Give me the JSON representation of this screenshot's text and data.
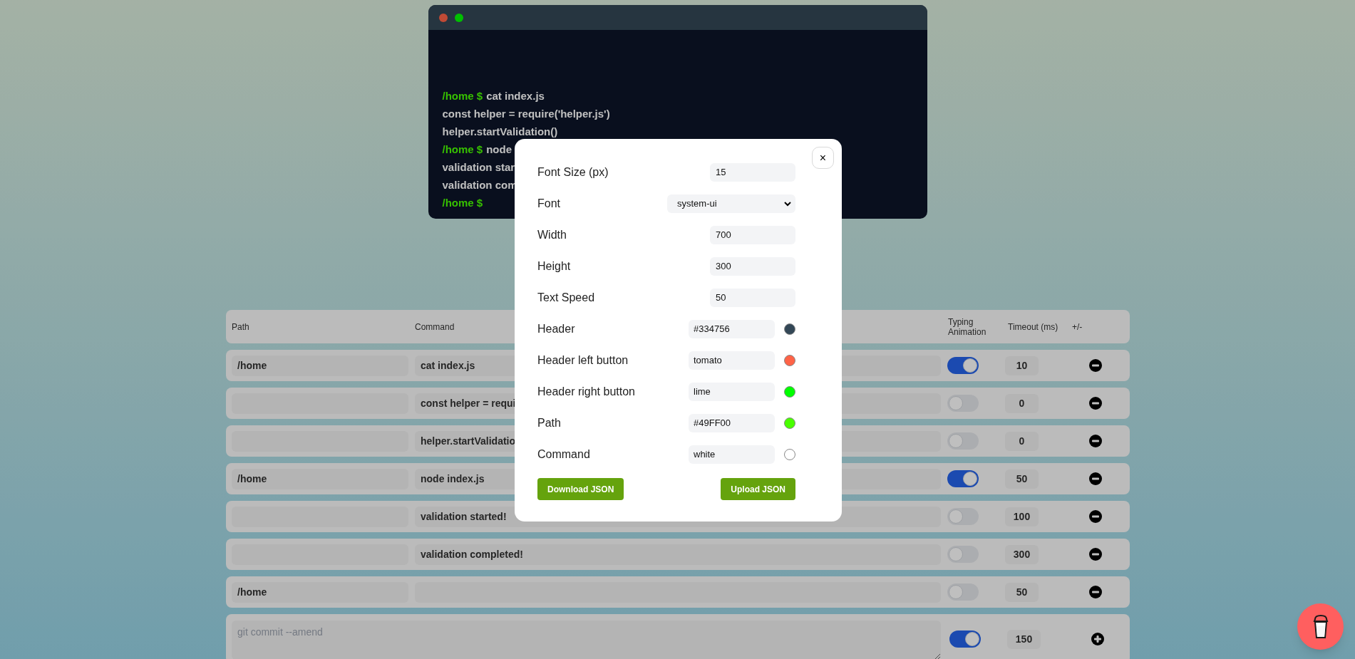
{
  "terminal": {
    "buttons": [
      {
        "color": "#bf4a35"
      },
      {
        "color": "#00bf00"
      }
    ],
    "lines": [
      {
        "path": "/home $",
        "command": "cat index.js"
      },
      {
        "command": "const helper = require('helper.js')"
      },
      {
        "command": "helper.startValidation()"
      },
      {
        "path": "/home $",
        "command": "node"
      },
      {
        "command": "validation star"
      },
      {
        "command": "validation com"
      },
      {
        "path": "/home $"
      }
    ]
  },
  "table": {
    "columns": [
      "Path",
      "Command",
      "Typing Animation",
      "Timeout (ms)",
      "+/-"
    ],
    "rows": [
      {
        "kind": "line",
        "path": "/home",
        "command": "cat index.js",
        "typing": true,
        "timeout": "10"
      },
      {
        "kind": "line",
        "command": "const helper = requi",
        "typing": false,
        "timeout": "0"
      },
      {
        "kind": "line",
        "command": "helper.startValidatio",
        "typing": false,
        "timeout": "0"
      },
      {
        "kind": "line",
        "path": "/home",
        "command": "node index.js",
        "typing": true,
        "timeout": "50"
      },
      {
        "kind": "line",
        "command": "validation started!",
        "typing": false,
        "timeout": "100"
      },
      {
        "kind": "line",
        "command": "validation completed!",
        "typing": false,
        "timeout": "300"
      },
      {
        "kind": "line",
        "path": "/home",
        "typing": false,
        "timeout": "50"
      },
      {
        "kind": "new",
        "placeholder": "git commit --amend",
        "typing": true,
        "timeout": "150"
      }
    ]
  },
  "settings": {
    "close": "×",
    "fields": [
      {
        "kind": "number",
        "label": "Font Size (px)",
        "value": "15"
      },
      {
        "kind": "select",
        "label": "Font",
        "value": "system-ui"
      },
      {
        "kind": "number",
        "label": "Width",
        "value": "700"
      },
      {
        "kind": "number",
        "label": "Height",
        "value": "300"
      },
      {
        "kind": "number",
        "label": "Text Speed",
        "value": "50"
      },
      {
        "kind": "color",
        "label": "Header",
        "value": "#334756",
        "color": "#334756"
      },
      {
        "kind": "color",
        "label": "Header left button",
        "value": "tomato",
        "color": "#ff6347"
      },
      {
        "kind": "color",
        "label": "Header right button",
        "value": "lime",
        "color": "#00ff00"
      },
      {
        "kind": "color",
        "label": "Path",
        "value": "#49FF00",
        "color": "#49ff00"
      },
      {
        "kind": "color",
        "label": "Command",
        "value": "white",
        "color": "#ffffff"
      }
    ],
    "buttons": [
      "Download JSON",
      "Upload JSON"
    ]
  }
}
